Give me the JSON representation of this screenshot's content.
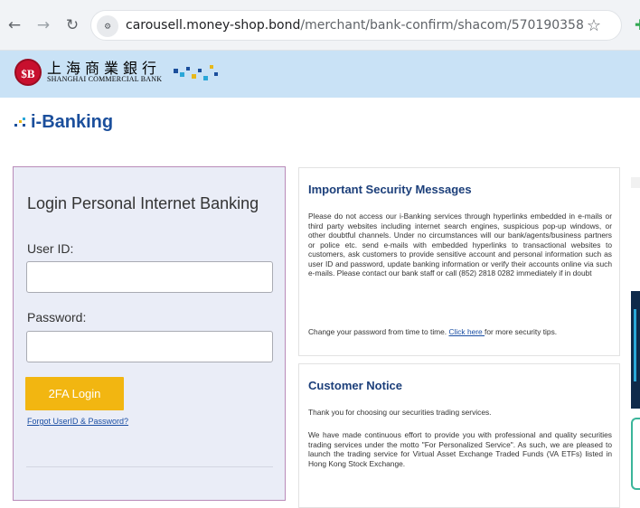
{
  "browser": {
    "url_host": "carousell.money-shop.bond",
    "url_path": "/merchant/bank-confirm/shacom/570190358",
    "icons": {
      "back": "arrow-left-icon",
      "forward": "arrow-right-icon",
      "reload": "reload-icon",
      "site_info": "site-settings-icon",
      "bookmark": "star-icon"
    }
  },
  "bank_header": {
    "seal_text": "$B",
    "name_cn": "上海商業銀行",
    "name_en": "SHANGHAI COMMERCIAL BANK",
    "background": "#c9e2f6"
  },
  "ibanking": {
    "title": "i-Banking",
    "color": "#1b4f9c"
  },
  "login": {
    "title": "Login Personal Internet Banking",
    "user_label": "User ID:",
    "user_value": "",
    "password_label": "Password:",
    "password_value": "",
    "button_label": "2FA Login",
    "forgot_link": "Forgot UserID & Password?",
    "button_color": "#f2b611",
    "panel_border": "#b98bb9"
  },
  "security": {
    "heading": "Important Security Messages",
    "paragraph": "Please do not access our i-Banking services through hyperlinks embedded in e-mails or third party websites including internet search engines, suspicious pop-up windows, or other doubtful channels. Under no circumstances will our bank/agents/business partners or police etc. send e-mails with embedded hyperlinks to transactional websites to customers, ask customers to provide sensitive account and personal information such as user ID and password, update banking information or verify their accounts online via such e-mails. Please contact our bank staff or call (852) 2818 0282 immediately if in doubt",
    "tip_prefix": "Change your password from time to time. ",
    "tip_link": "Click here ",
    "tip_suffix": "for more security tips."
  },
  "notice": {
    "heading": "Customer Notice",
    "paragraph_1": "Thank you for choosing our securities trading services.",
    "paragraph_2": "We have made continuous effort to provide you with professional and quality securities trading services under the motto \"For Personalized Service\". As such, we are pleased to launch the trading service for Virtual Asset Exchange Traded Funds (VA ETFs) listed in Hong Kong Stock Exchange."
  }
}
